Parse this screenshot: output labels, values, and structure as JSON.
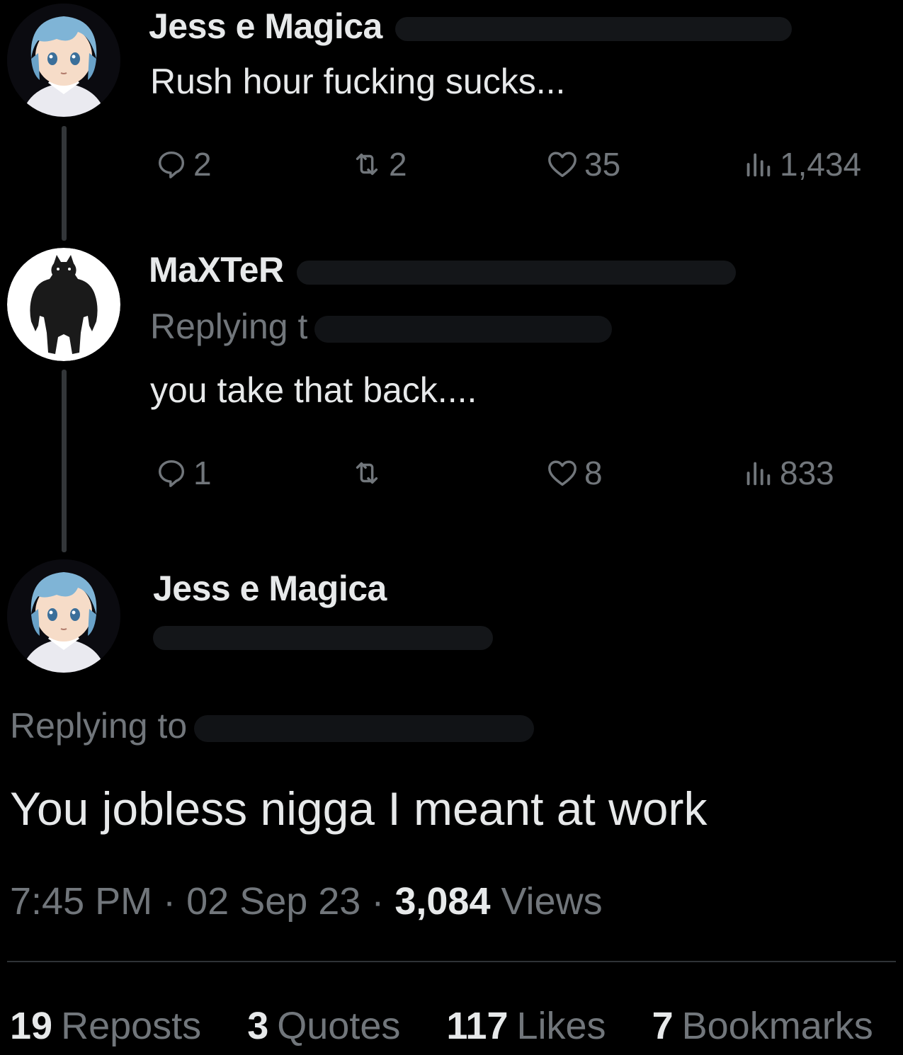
{
  "thread": {
    "tweet1": {
      "author": "Jess e Magica",
      "avatar_icon": "anime-avatar-icon",
      "text": "Rush hour fucking sucks...",
      "replies": "2",
      "reposts": "2",
      "likes": "35",
      "views": "1,434"
    },
    "tweet2": {
      "author": "MaXTeR",
      "avatar_icon": "werewolf-avatar-icon",
      "replying_label": "Replying t",
      "text": "you take that back....",
      "replies": "1",
      "reposts": "",
      "likes": "8",
      "views": "833"
    },
    "main": {
      "author": "Jess e Magica",
      "avatar_icon": "anime-avatar-icon",
      "replying_label": "Replying to",
      "text": "You jobless nigga I meant at work",
      "time": "7:45 PM",
      "date": "02 Sep 23",
      "views_count": "3,084",
      "views_label": "Views",
      "separator": "·"
    },
    "stats": {
      "reposts_count": "19",
      "reposts_label": "Reposts",
      "quotes_count": "3",
      "quotes_label": "Quotes",
      "likes_count": "117",
      "likes_label": "Likes",
      "bookmarks_count": "7",
      "bookmarks_label": "Bookmarks"
    }
  },
  "colors": {
    "background": "#000000",
    "primary_text": "#e7e9ea",
    "secondary_text": "#71767b",
    "thread_line": "#333639"
  }
}
